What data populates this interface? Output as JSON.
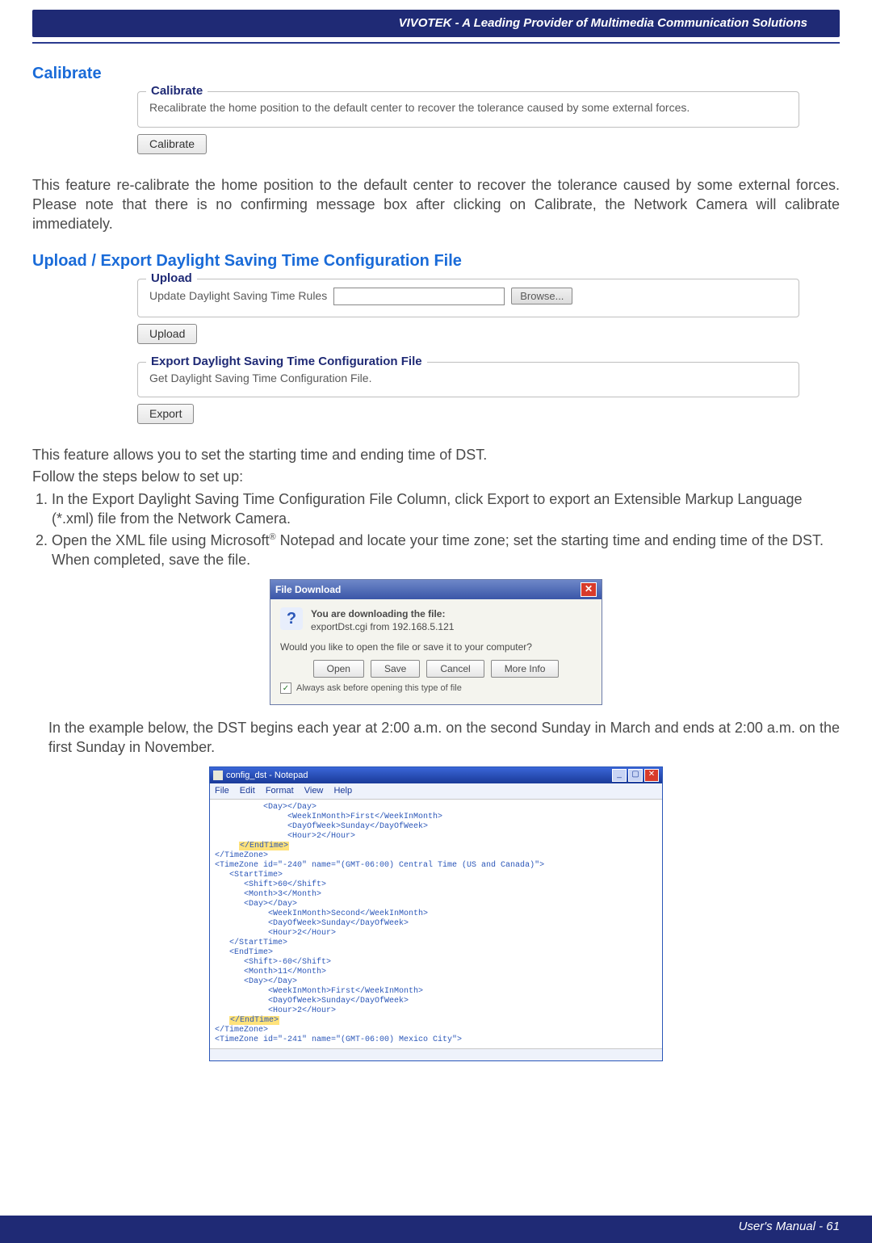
{
  "topbar": {
    "title": "VIVOTEK - A Leading Provider of Multimedia Communication Solutions"
  },
  "calibrate": {
    "heading": "Calibrate",
    "legend": "Calibrate",
    "text": "Recalibrate the home position to the default center to recover the tolerance caused by some external forces.",
    "button": "Calibrate",
    "paragraph": "This feature re-calibrate the home position to the default center to recover the tolerance caused by some external forces. Please note that there is no confirming message box after clicking on Calibrate, the Network Camera will calibrate immediately."
  },
  "updst": {
    "heading": "Upload / Export Daylight Saving Time Configuration File",
    "upload_legend": "Upload",
    "upload_label": "Update Daylight Saving Time Rules",
    "browse": "Browse...",
    "upload_button": "Upload",
    "export_legend": "Export Daylight Saving Time Configuration File",
    "export_text": "Get Daylight Saving Time Configuration File.",
    "export_button": "Export",
    "intro1": "This feature allows you to set the starting time and ending time of DST.",
    "intro2": "Follow the steps below to set up:",
    "step1": "In the Export Daylight Saving Time Configuration File Column, click Export to export an Extensible Markup Language (*.xml) file from the Network Camera.",
    "step2a": "Open the XML file using Microsoft",
    "step2_reg": "®",
    "step2b": " Notepad and locate your time zone; set the starting time and ending time of the DST. When completed, save the file.",
    "example_note": "In the example below, the DST begins each year at 2:00 a.m. on the second Sunday in March and ends at 2:00 a.m. on the first Sunday in November."
  },
  "filedlg": {
    "title": "File Download",
    "l1": "You are downloading the file:",
    "l2": "exportDst.cgi from 192.168.5.121",
    "l3": "Would you like to open the file or save it to your computer?",
    "open": "Open",
    "save": "Save",
    "cancel": "Cancel",
    "more": "More Info",
    "always": "Always ask before opening this type of file"
  },
  "np": {
    "title": "config_dst - Notepad",
    "menu": {
      "file": "File",
      "edit": "Edit",
      "format": "Format",
      "view": "View",
      "help": "Help"
    },
    "code_pre": "          <Day></Day>\n               <WeekInMonth>First</WeekInMonth>\n               <DayOfWeek>Sunday</DayOfWeek>\n               <Hour>2</Hour>\n     ",
    "hl1": "</EndTime>",
    "code_mid": "\n</TimeZone>\n<TimeZone id=\"-240\" name=\"(GMT-06:00) Central Time (US and Canada)\">\n   <StartTime>\n      <Shift>60</Shift>\n      <Month>3</Month>\n      <Day></Day>\n           <WeekInMonth>Second</WeekInMonth>\n           <DayOfWeek>Sunday</DayOfWeek>\n           <Hour>2</Hour>\n   </StartTime>\n   <EndTime>\n      <Shift>-60</Shift>\n      <Month>11</Month>\n      <Day></Day>\n           <WeekInMonth>First</WeekInMonth>\n           <DayOfWeek>Sunday</DayOfWeek>\n           <Hour>2</Hour>\n   ",
    "hl2": "</EndTime>",
    "code_post": "\n</TimeZone>\n<TimeZone id=\"-241\" name=\"(GMT-06:00) Mexico City\">"
  },
  "footer": {
    "text": "User's Manual - 61"
  }
}
